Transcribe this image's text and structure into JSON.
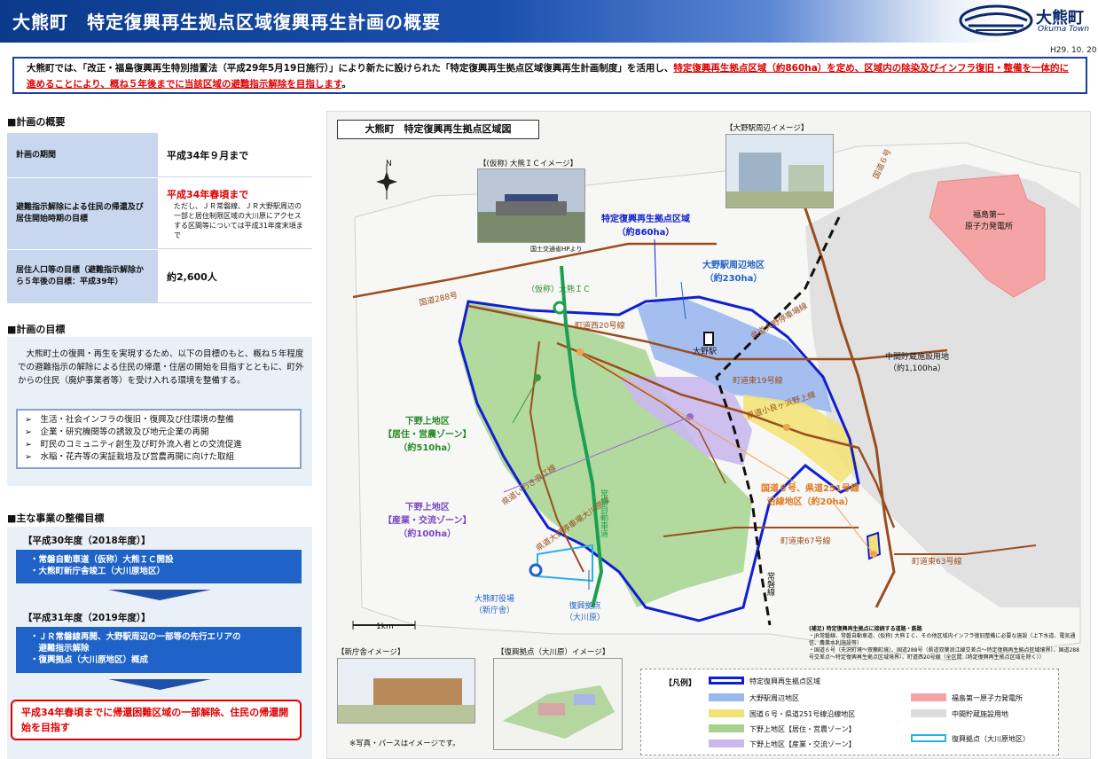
{
  "header": {
    "title": "大熊町　特定復興再生拠点区域復興再生計画の概要",
    "logo_text": "大熊町",
    "logo_sub": "Okuma Town",
    "date": "H29. 10. 20"
  },
  "intro": {
    "part1": "大熊町では、「改正・福島復興再生特別措置法（平成29年5月19日施行）」により新たに設けられた「特定復興再生拠点区域復興再生計画制度」を活用し、",
    "part2": "特定復興再生拠点区域（約860ha）を定め、区域内の除染及びインフラ復旧・整備を一体的に進めることにより、概ね５年後までに当該区域の避難指示解除を目指します",
    "part3": "。"
  },
  "plan_overview": {
    "heading": "■計画の概要",
    "rows": [
      {
        "label": "計画の期間",
        "value": "平成34年９月まで"
      },
      {
        "label": "避難指示解除による住民の帰還及び居住開始時期の目標",
        "value_red": "平成34年春頃まで",
        "value_note": "ただし、ＪＲ常磐線、ＪＲ大野駅周辺の一部と居住制限区域の大川原にアクセスする区間等については平成31年度末頃まで"
      },
      {
        "label": "居住人口等の目標（避難指示解除から５年後の目標：平成39年）",
        "value": "約2,600人"
      }
    ]
  },
  "plan_goal": {
    "heading": "■計画の目標",
    "text": "大熊町土の復興・再生を実現するため、以下の目標のもと、概ね５年程度での避難指示の解除による住民の帰還・住居の開始を目指すとともに、町外からの住民（廃炉事業者等）を受け入れる環境を整備する。",
    "items": [
      "➢　生活・社会インフラの復旧・復興及び住環境の整備",
      "➢　企業・研究機関等の誘致及び地元企業の再開",
      "➢　町民のコミュニティ創生及び町外流入者との交流促進",
      "➢　水稲・花卉等の実証栽培及び営農再開に向けた取組"
    ]
  },
  "projects": {
    "heading": "■主な事業の整備目標",
    "y2018": {
      "label": "【平成30年度（2018年度）】",
      "lines": [
        "・常磐自動車道（仮称）大熊ＩＣ開設",
        "・大熊町新庁舎竣工（大川原地区）"
      ]
    },
    "y2019": {
      "label": "【平成31年度（2019年度）】",
      "lines": [
        "・ＪＲ常磐線再開、大野駅周辺の一部等の先行エリアの",
        "　避難指示解除",
        "・復興拠点（大川原地区）概成"
      ]
    },
    "goal": "平成34年春頃までに帰還困難区域の一部解除、住民の帰還開始を目指す"
  },
  "map": {
    "title": "大熊町　特定復興再生拠点区域図",
    "labels": {
      "zone_main": "特定復興再生拠点区域",
      "zone_main_area": "（約860ha）",
      "ono": "大野駅周辺地区",
      "ono_area": "（約230ha）",
      "shimono_kami_res": "下野上地区",
      "shimono_kami_res_zone": "【居住・営農ゾーン】",
      "shimono_kami_res_area": "（約510ha）",
      "shimono_kami_ind": "下野上地区",
      "shimono_kami_ind_zone": "【産業・交流ゾーン】",
      "shimono_kami_ind_area": "（約100ha）",
      "route6": "国道６号、県道251号線",
      "route6_2": "沿線地区（約20ha）",
      "plant": "福島第一",
      "plant2": "原子力発電所",
      "storage": "中間貯蔵施設用地",
      "storage2": "（約1,100ha）",
      "station": "大野駅",
      "ic": "（仮称）大熊ＩＣ",
      "office": "大熊町役場",
      "office2": "（新庁舎）",
      "base": "復興拠点",
      "base2": "（大川原）",
      "jr": "常磐線",
      "expressway": "常磐自動車道",
      "rt288": "国道288号",
      "rt6": "国道６号",
      "town20": "町道西20号線",
      "town19": "町道東19号線",
      "town67": "町道東67号線",
      "town63": "町道東63号線",
      "pref251": "県道小良ヶ浜野上線",
      "pref35": "県道大野停車場線",
      "pref_iwaki": "県道いわき浪江線",
      "pref_ono": "県道大野停車場大川原線",
      "scale": "1km",
      "north": "N"
    },
    "photo_ic_cap": "【(仮称) 大熊ＩＣイメージ】",
    "photo_ic_credit": "国土交通省HPより",
    "photo_station_cap": "【大野駅周辺イメージ】",
    "photo_office_cap": "【新庁舎イメージ】",
    "photo_base_cap": "【復興拠点（大川原）イメージ】",
    "photo_note": "※写真・パースはイメージです。",
    "note_title": "(補足) 特定復興再生拠点に接続する道路・鉄路",
    "note_lines": [
      "・JR常磐線、常磐自動車道、(仮称) 大熊ＩＣ、その他区域内インフラ復旧整備に必要な施設（上下水道、電気通信、農業水利施設等）",
      "・国道６号（夫沢町境～双葉町境）、国道288号（県道双葉浪江線交差点～特定復興再生拠点区域境界）、国道288号交差点～特定復興再生拠点区域境界）、町道西20号線（全区間（特定復興再生拠点区域を除く））"
    ]
  },
  "legend": {
    "title": "【凡例】",
    "items": [
      "特定復興再生拠点区域",
      "大野駅周辺地区",
      "国道６号・県道251号線沿線地区",
      "下野上地区【居住・営農ゾーン】",
      "下野上地区【産業・交流ゾーン】",
      "福島第一原子力発電所",
      "中間貯蔵施設用地",
      "復興拠点（大川原地区）"
    ]
  },
  "colors": {
    "header_blue": "#0b3a8a",
    "zone_outline": "#1020d0",
    "ono_fill": "#9ab7ee",
    "route_fill": "#f3e27a",
    "res_fill": "#a6d48e",
    "ind_fill": "#c9b8ee",
    "plant_fill": "#f4a4a4",
    "storage_fill": "#dcdcdc",
    "road": "#9a4e1e",
    "red": "#e00000"
  }
}
